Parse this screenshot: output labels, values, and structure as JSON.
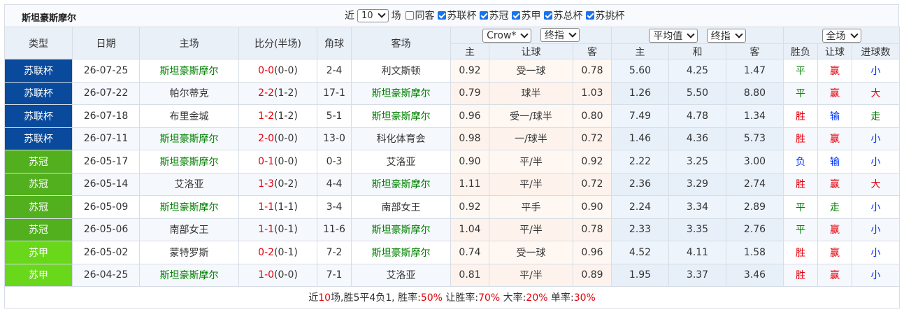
{
  "team_title": "斯坦豪斯摩尔",
  "filters": {
    "recent_prefix": "近",
    "recent_count": "10",
    "recent_suffix": "场",
    "same_home_label": "同客",
    "same_home_checked": false,
    "leagues": [
      {
        "label": "苏联杯",
        "checked": true
      },
      {
        "label": "苏冠",
        "checked": true
      },
      {
        "label": "苏甲",
        "checked": true
      },
      {
        "label": "苏总杯",
        "checked": true
      },
      {
        "label": "苏挑杯",
        "checked": true
      }
    ]
  },
  "header": {
    "type": "类型",
    "date": "日期",
    "home": "主场",
    "score": "比分(半场)",
    "corners": "角球",
    "away": "客场",
    "ah_company": "Crow*",
    "ah_stage": "终指",
    "eu_kind": "平均值",
    "eu_stage": "终指",
    "result_scope": "全场",
    "ah_home": "主",
    "ah_handicap": "让球",
    "ah_away": "客",
    "eu_home": "主",
    "eu_draw": "和",
    "eu_away": "客",
    "res_wdl": "胜负",
    "res_ah": "让球",
    "res_ou": "进球数"
  },
  "colors": {
    "league_cup": "#0a4a9c",
    "league_premiership": "#52b01e",
    "league_championship": "#6ad81a",
    "win": "#e4000b",
    "loss": "#0033ff",
    "draw": "#008000"
  },
  "matches": [
    {
      "league": "苏联杯",
      "date": "26-07-25",
      "home": "斯坦豪斯摩尔",
      "score": "0-0",
      "half": "(0-0)",
      "corners": "2-4",
      "away": "利文斯顿",
      "ah_h": "0.92",
      "ah_line": "受一球",
      "ah_a": "0.78",
      "eu_h": "5.60",
      "eu_d": "4.25",
      "eu_a": "1.47",
      "wdl": "平",
      "ah_res": "赢",
      "ou": "小"
    },
    {
      "league": "苏联杯",
      "date": "26-07-22",
      "home": "帕尔蒂克",
      "score": "2-2",
      "half": "(1-2)",
      "corners": "17-1",
      "away": "斯坦豪斯摩尔",
      "ah_h": "0.79",
      "ah_line": "球半",
      "ah_a": "1.03",
      "eu_h": "1.26",
      "eu_d": "5.50",
      "eu_a": "8.80",
      "wdl": "平",
      "ah_res": "赢",
      "ou": "大"
    },
    {
      "league": "苏联杯",
      "date": "26-07-18",
      "home": "布里金城",
      "score": "1-2",
      "half": "(1-2)",
      "corners": "5-1",
      "away": "斯坦豪斯摩尔",
      "ah_h": "0.96",
      "ah_line": "受一/球半",
      "ah_a": "0.80",
      "eu_h": "7.49",
      "eu_d": "4.78",
      "eu_a": "1.34",
      "wdl": "胜",
      "ah_res": "输",
      "ou": "走"
    },
    {
      "league": "苏联杯",
      "date": "26-07-11",
      "home": "斯坦豪斯摩尔",
      "score": "2-0",
      "half": "(0-0)",
      "corners": "13-0",
      "away": "科化体育会",
      "ah_h": "0.98",
      "ah_line": "一/球半",
      "ah_a": "0.72",
      "eu_h": "1.46",
      "eu_d": "4.36",
      "eu_a": "5.73",
      "wdl": "胜",
      "ah_res": "赢",
      "ou": "小"
    },
    {
      "league": "苏冠",
      "date": "26-05-17",
      "home": "斯坦豪斯摩尔",
      "score": "0-1",
      "half": "(0-0)",
      "corners": "0-3",
      "away": "艾洛亚",
      "ah_h": "0.90",
      "ah_line": "平/半",
      "ah_a": "0.92",
      "eu_h": "2.22",
      "eu_d": "3.25",
      "eu_a": "3.00",
      "wdl": "负",
      "ah_res": "输",
      "ou": "小"
    },
    {
      "league": "苏冠",
      "date": "26-05-14",
      "home": "艾洛亚",
      "score": "1-3",
      "half": "(0-2)",
      "corners": "4-4",
      "away": "斯坦豪斯摩尔",
      "ah_h": "1.11",
      "ah_line": "平/半",
      "ah_a": "0.72",
      "eu_h": "2.36",
      "eu_d": "3.29",
      "eu_a": "2.74",
      "wdl": "胜",
      "ah_res": "赢",
      "ou": "大"
    },
    {
      "league": "苏冠",
      "date": "26-05-09",
      "home": "斯坦豪斯摩尔",
      "score": "1-1",
      "half": "(1-1)",
      "corners": "3-4",
      "away": "南部女王",
      "ah_h": "0.92",
      "ah_line": "平手",
      "ah_a": "0.90",
      "eu_h": "2.24",
      "eu_d": "3.34",
      "eu_a": "2.89",
      "wdl": "平",
      "ah_res": "走",
      "ou": "小"
    },
    {
      "league": "苏冠",
      "date": "26-05-06",
      "home": "南部女王",
      "score": "1-1",
      "half": "(0-1)",
      "corners": "11-6",
      "away": "斯坦豪斯摩尔",
      "ah_h": "1.04",
      "ah_line": "平/半",
      "ah_a": "0.78",
      "eu_h": "2.33",
      "eu_d": "3.35",
      "eu_a": "2.76",
      "wdl": "平",
      "ah_res": "赢",
      "ou": "小"
    },
    {
      "league": "苏甲",
      "date": "26-05-02",
      "home": "蒙特罗斯",
      "score": "0-2",
      "half": "(0-1)",
      "corners": "7-2",
      "away": "斯坦豪斯摩尔",
      "ah_h": "0.74",
      "ah_line": "受一球",
      "ah_a": "0.96",
      "eu_h": "4.52",
      "eu_d": "4.11",
      "eu_a": "1.58",
      "wdl": "胜",
      "ah_res": "赢",
      "ou": "小"
    },
    {
      "league": "苏甲",
      "date": "26-04-25",
      "home": "斯坦豪斯摩尔",
      "score": "1-0",
      "half": "(0-0)",
      "corners": "7-1",
      "away": "艾洛亚",
      "ah_h": "0.81",
      "ah_line": "平/半",
      "ah_a": "0.89",
      "eu_h": "1.95",
      "eu_d": "3.37",
      "eu_a": "3.46",
      "wdl": "胜",
      "ah_res": "赢",
      "ou": "小"
    }
  ],
  "summary": {
    "t1": "近",
    "n_matches": "10",
    "t2": "场,胜5平4负1, 胜率:",
    "win_rate": "50%",
    "t3": " 让胜率:",
    "ah_rate": "70%",
    "t4": " 大率:",
    "over_rate": "20%",
    "t5": " 单率:",
    "odd_rate": "30%"
  }
}
